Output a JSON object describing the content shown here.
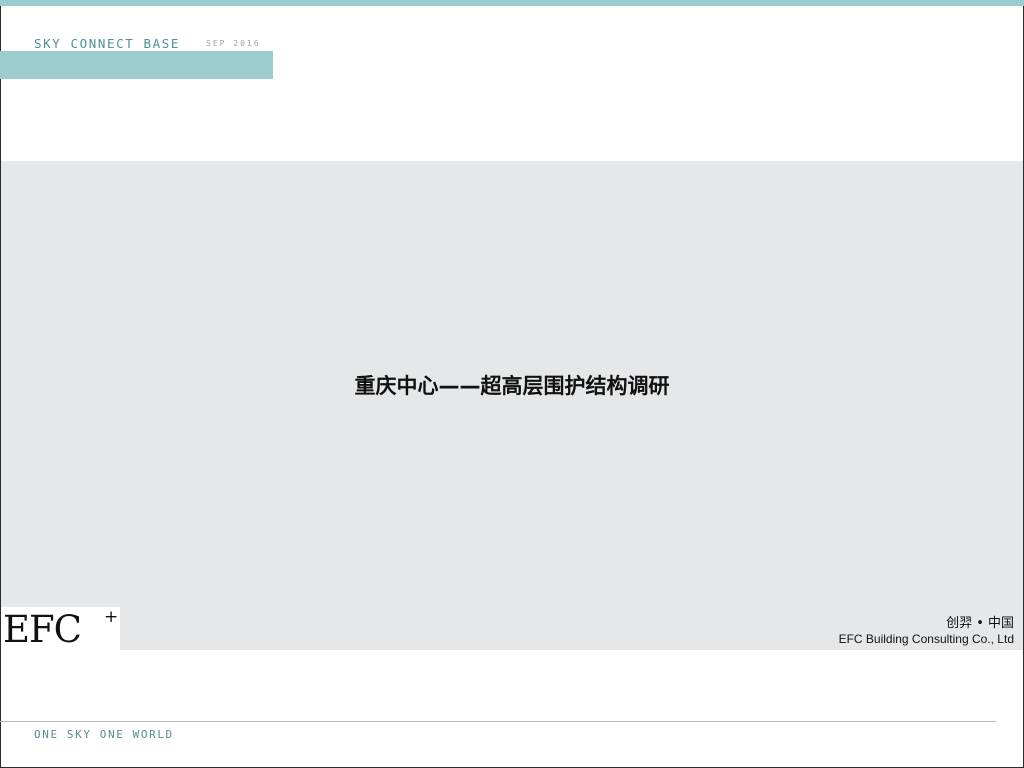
{
  "header": {
    "title": "SKY CONNECT BASE",
    "date": "SEP 2016"
  },
  "slide": {
    "title": "重庆中心——超高层围护结构调研"
  },
  "logo": {
    "text": "EFC",
    "superscript": "+"
  },
  "company": {
    "name_cn": "创羿 • 中国",
    "name_en": "EFC Building Consulting Co., Ltd"
  },
  "footer": {
    "slogan": "ONE SKY ONE WORLD"
  },
  "colors": {
    "accent": "#9ccccd",
    "accent_text": "#4e8f94",
    "panel": "#e6e7e8"
  }
}
